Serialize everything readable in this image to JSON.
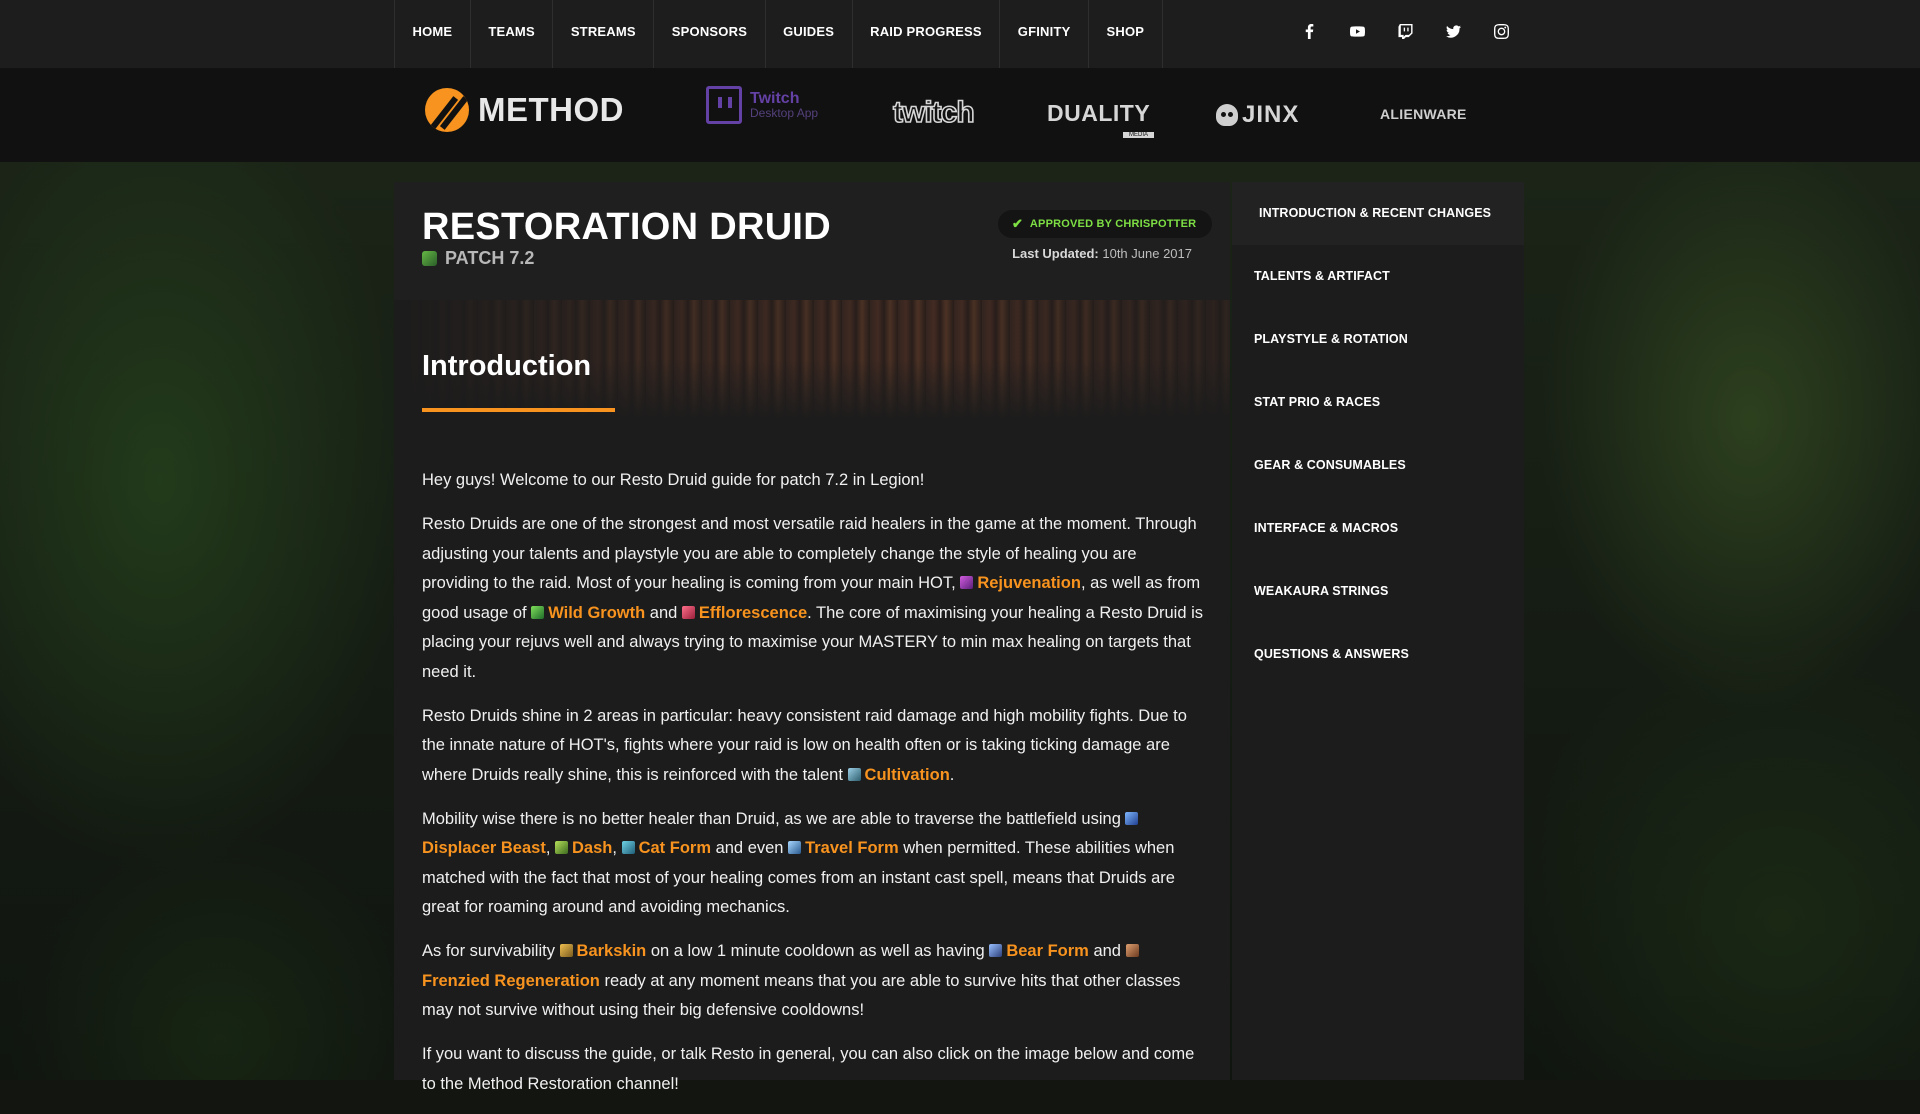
{
  "nav": {
    "items": [
      "HOME",
      "TEAMS",
      "STREAMS",
      "SPONSORS",
      "GUIDES",
      "RAID PROGRESS",
      "GFINITY",
      "SHOP"
    ],
    "socials": [
      "facebook-icon",
      "youtube-icon",
      "twitch-icon",
      "twitter-icon",
      "instagram-icon"
    ]
  },
  "sponsors": {
    "method": "METHOD",
    "twitch_app_line1": "Twitch",
    "twitch_app_line2": "Desktop App",
    "twitch": "twitch",
    "duality": "DUALITY",
    "duality_sub": "MEDIA",
    "jinx": "JINX",
    "alienware": "ALIENWARE"
  },
  "guide": {
    "title": "RESTORATION DRUID",
    "patch": "PATCH 7.2",
    "approved": "APPROVED BY CHRISPOTTER",
    "updated_label": "Last Updated:",
    "updated_value": "10th June 2017",
    "section_heading": "Introduction",
    "p1": "Hey guys! Welcome to our Resto Druid guide for patch 7.2 in Legion!",
    "p2": {
      "t1": "Resto Druids are one of the strongest and most versatile raid healers in the game at the moment. Through adjusting your talents and playstyle you are able to completely change the style of healing you are providing to the raid. Most of your healing is coming from your main HOT,",
      "s1": "Rejuvenation",
      "t2": ", as well as from good usage of",
      "s2": "Wild Growth",
      "t3": "and",
      "s3": "Efflorescence",
      "t4": ". The core of maximising your healing a Resto Druid is placing your rejuvs well and always trying to maximise your MASTERY to min max healing on targets that need it."
    },
    "p3": {
      "t1": "Resto Druids shine in 2 areas in particular: heavy consistent raid damage and high mobility fights. Due to the innate nature of HOT's, fights where your raid is low on health often or is taking ticking damage are where Druids really shine, this is reinforced with the talent",
      "s1": "Cultivation",
      "t2": "."
    },
    "p4": {
      "t1": "Mobility wise there is no better healer than Druid, as we are able to traverse the battlefield using",
      "s1": "Displacer Beast",
      "t2": ",",
      "s2": "Dash",
      "t3": ",",
      "s3": "Cat Form",
      "t4": "and even",
      "s4": "Travel Form",
      "t5": "when permitted. These abilities when matched with the fact that most of your healing comes from an instant cast spell, means that Druids are great for roaming around and avoiding mechanics."
    },
    "p5": {
      "t1": "As for survivability",
      "s1": "Barkskin",
      "t2": "on a low 1 minute cooldown as well as having",
      "s2": "Bear Form",
      "t3": "and",
      "s3": "Frenzied Regeneration",
      "t4": "ready at any moment means that you are able to survive hits that other classes may not survive without using their big defensive cooldowns!"
    },
    "p6": "If you want to discuss the guide, or talk Resto in general, you can also click on the image below and come to the Method Restoration channel!"
  },
  "sidebar": {
    "items": [
      "INTRODUCTION & RECENT CHANGES",
      "TALENTS & ARTIFACT",
      "PLAYSTYLE & ROTATION",
      "STAT PRIO & RACES",
      "GEAR & CONSUMABLES",
      "INTERFACE & MACROS",
      "WEAKAURA STRINGS",
      "QUESTIONS & ANSWERS"
    ]
  },
  "colors": {
    "accent": "#f7931e",
    "approved": "#7ddf44",
    "topbar": "#1d1d1d",
    "panel": "#1c1c1c"
  }
}
